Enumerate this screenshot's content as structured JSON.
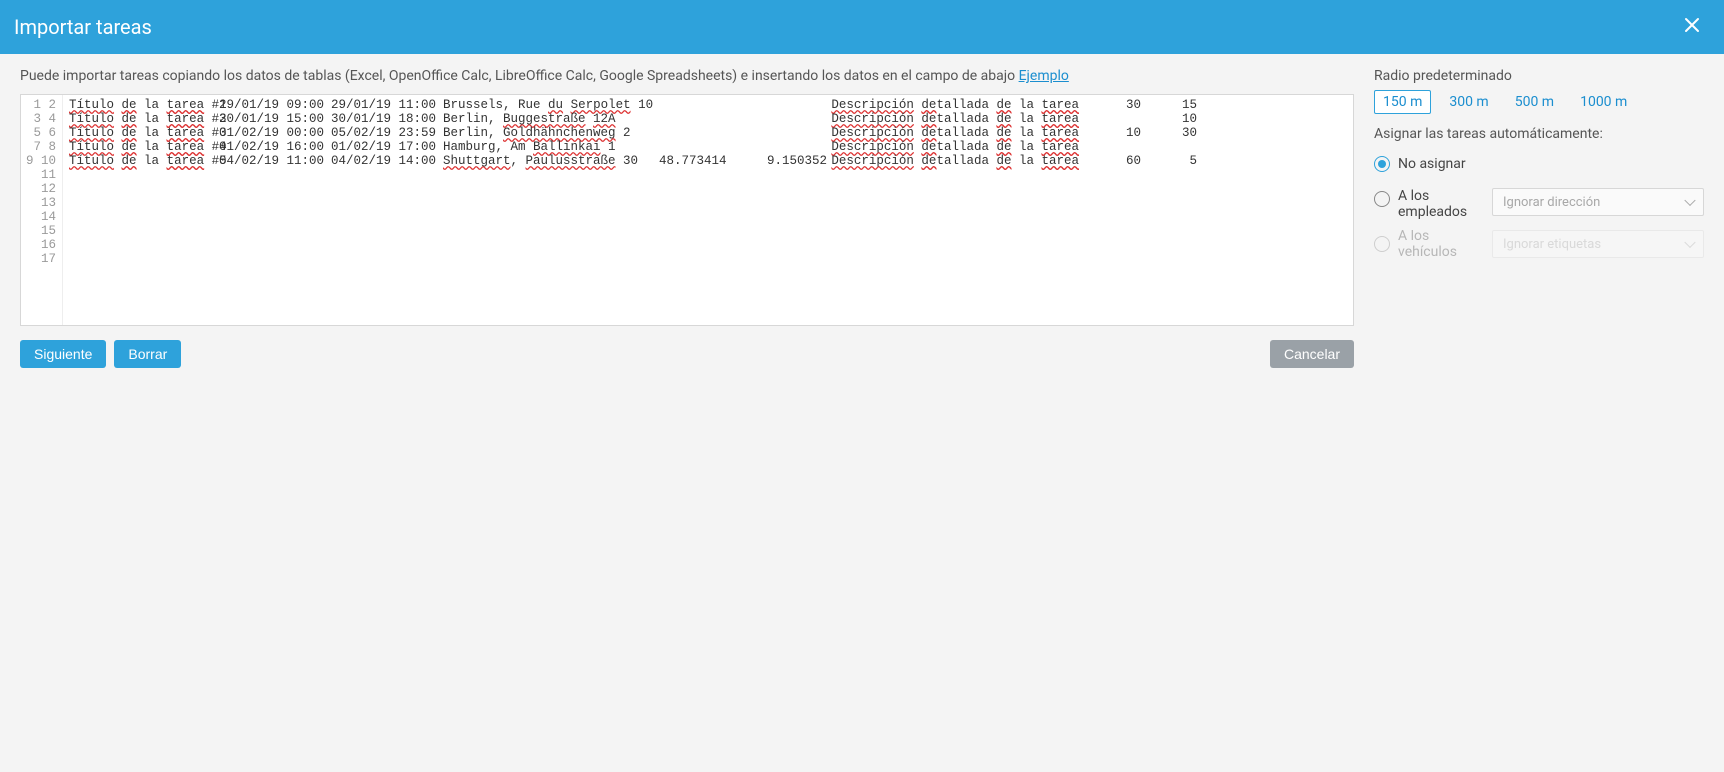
{
  "header": {
    "title": "Importar tareas"
  },
  "intro": {
    "text": "Puede importar tareas copiando los datos de tablas (Excel, OpenOffice Calc, LibreOffice Calc, Google Spreadsheets) e insertando los datos en el campo de abajo ",
    "example_link": "Ejemplo"
  },
  "editor": {
    "visible_line_count": 17,
    "rows": [
      {
        "title": "Título de la tarea #1",
        "from": "29/01/19 09:00",
        "to": "29/01/19 11:00",
        "address": "Brussels, Rue du Serpolet 10",
        "lat": "",
        "lng": "",
        "desc": "Descripción detallada de la tarea",
        "v1": "30",
        "v2": "15"
      },
      {
        "title": "Título de la tarea #2",
        "from": "30/01/19 15:00",
        "to": "30/01/19 18:00",
        "address": "Berlin, Buggestraße 12A",
        "lat": "",
        "lng": "",
        "desc": "Descripción detallada de la tarea",
        "v1": "",
        "v2": "10"
      },
      {
        "title": "Título de la tarea #3",
        "from": "01/02/19 00:00",
        "to": "05/02/19 23:59",
        "address": "Berlin, Goldhähnchenweg 2",
        "lat": "",
        "lng": "",
        "desc": "Descripción detallada de la tarea",
        "v1": "10",
        "v2": "30"
      },
      {
        "title": "Título de la tarea #4",
        "from": "01/02/19 16:00",
        "to": "01/02/19 17:00",
        "address": "Hamburg, Am Ballinkai 1",
        "lat": "",
        "lng": "",
        "desc": "Descripción detallada de la tarea",
        "v1": "",
        "v2": ""
      },
      {
        "title": "Título de la tarea #5",
        "from": "04/02/19 11:00",
        "to": "04/02/19 14:00",
        "address": "Shuttgart, Paulusstraße 30",
        "lat": "48.773414",
        "lng": "9.150352",
        "desc": "Descripción detallada de la tarea",
        "v1": "60",
        "v2": "5"
      }
    ],
    "spell_sets": [
      [
        "Título",
        "de",
        "tarea",
        "du",
        "Serpolet",
        "Descripción",
        "detallada",
        "de",
        "tarea"
      ],
      [
        "Título",
        "de",
        "tarea",
        "Buggestraße",
        "12A",
        "Descripción",
        "detallada",
        "de",
        "tarea"
      ],
      [
        "Título",
        "de",
        "tarea",
        "Goldhähnchenweg",
        "Descripción",
        "detallada",
        "de",
        "tarea"
      ],
      [
        "Título",
        "de",
        "tarea",
        "Ballinkai",
        "Descripción",
        "detallada",
        "de",
        "tarea"
      ],
      [
        "Título",
        "de",
        "tarea",
        "Shuttgart",
        "Paulusstraße",
        "Descripción",
        "detallada",
        "de",
        "tarea"
      ]
    ]
  },
  "buttons": {
    "next": "Siguiente",
    "clear": "Borrar",
    "cancel": "Cancelar"
  },
  "sidebar": {
    "radius_label": "Radio predeterminado",
    "radius_options": [
      "150 m",
      "300 m",
      "500 m",
      "1000 m"
    ],
    "radius_selected_index": 0,
    "assign_label": "Asignar las tareas automáticamente:",
    "assign_options": [
      {
        "label": "No asignar",
        "select": null
      },
      {
        "label_line1": "A los",
        "label_line2": "empleados",
        "select": "Ignorar dirección"
      },
      {
        "label_line1": "A los vehículos",
        "select": "Ignorar etiquetas"
      }
    ],
    "assign_selected_index": 0
  }
}
